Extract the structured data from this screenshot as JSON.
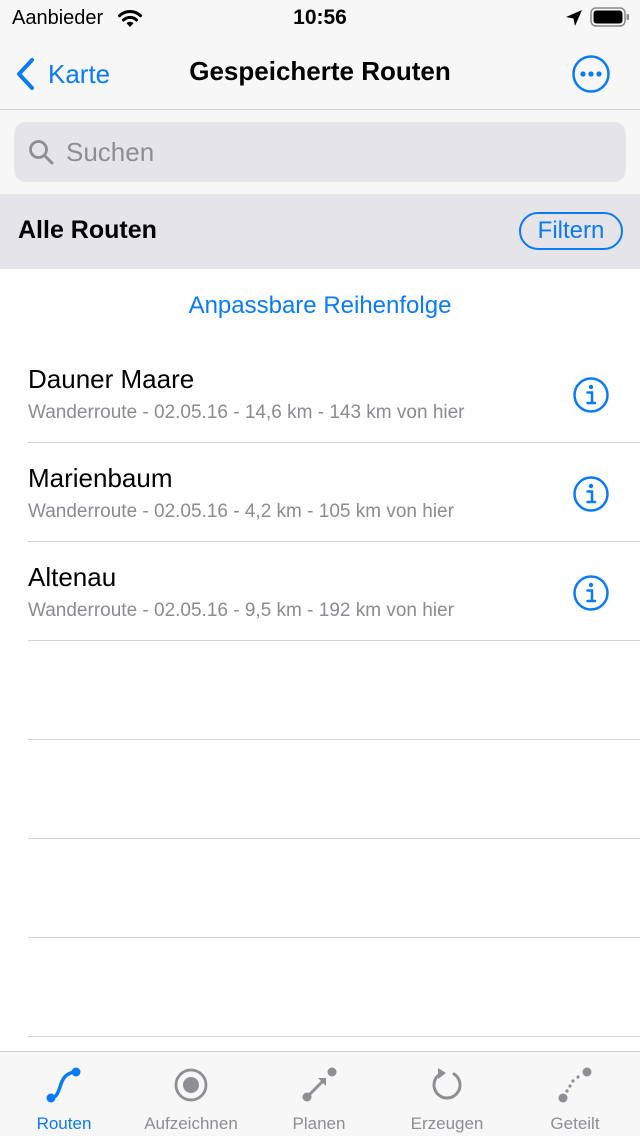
{
  "status_bar": {
    "carrier": "Aanbieder",
    "time": "10:56"
  },
  "nav": {
    "back_label": "Karte",
    "title": "Gespeicherte Routen"
  },
  "search": {
    "placeholder": "Suchen",
    "value": ""
  },
  "section": {
    "title": "Alle Routen",
    "filter_label": "Filtern"
  },
  "sort_label": "Anpassbare Reihenfolge",
  "routes": [
    {
      "name": "Dauner Maare",
      "meta": "Wanderroute - 02.05.16 - 14,6 km - 143 km von hier"
    },
    {
      "name": "Marienbaum",
      "meta": "Wanderroute - 02.05.16 - 4,2 km - 105 km von hier"
    },
    {
      "name": "Altenau",
      "meta": "Wanderroute - 02.05.16 - 9,5 km - 192 km von hier"
    }
  ],
  "tabs": [
    {
      "label": "Routen",
      "icon": "route-icon",
      "active": true
    },
    {
      "label": "Aufzeichnen",
      "icon": "record-icon",
      "active": false
    },
    {
      "label": "Planen",
      "icon": "plan-icon",
      "active": false
    },
    {
      "label": "Erzeugen",
      "icon": "generate-icon",
      "active": false
    },
    {
      "label": "Geteilt",
      "icon": "shared-icon",
      "active": false
    }
  ],
  "colors": {
    "accent": "#0a7bf7",
    "inactive": "#8e8e93",
    "bar_bg": "#f7f7f7",
    "section_bg": "#e4e4e9"
  }
}
